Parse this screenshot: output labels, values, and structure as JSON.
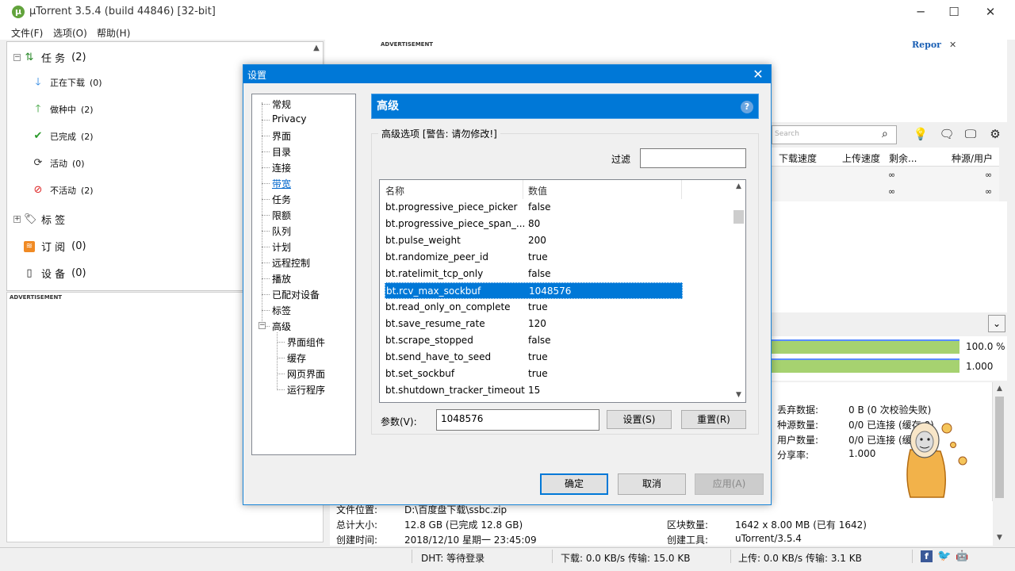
{
  "window": {
    "title": "µTorrent 3.5.4  (build 44846) [32-bit]",
    "app_icon_glyph": "µ",
    "minimize_glyph": "─",
    "maximize_glyph": "☐",
    "close_glyph": "✕"
  },
  "menu": {
    "file": "文件(F)",
    "options": "选项(O)",
    "help": "帮助(H)"
  },
  "sidebar": {
    "tasks_header": {
      "label": "任 务",
      "count": "(2)"
    },
    "items": [
      {
        "label": "正在下载",
        "count": "(0)",
        "icon": "arrow-down-icon"
      },
      {
        "label": "做种中",
        "count": "(2)",
        "icon": "arrow-up-icon"
      },
      {
        "label": "已完成",
        "count": "(2)",
        "icon": "check-icon"
      },
      {
        "label": "活动",
        "count": "(0)",
        "icon": "refresh-icon"
      },
      {
        "label": "不活动",
        "count": "(2)",
        "icon": "inactive-icon"
      }
    ],
    "labels": {
      "label": "标 签"
    },
    "feeds": {
      "label": "订 阅",
      "count": "(0)"
    },
    "devices": {
      "label": "设 备",
      "count": "(0)"
    },
    "expand_glyph": "+",
    "collapse_glyph": "−",
    "advertisement": "ADVERTISEMENT"
  },
  "top_ad": {
    "label": "ADVERTISEMENT",
    "report": "Repor",
    "close": "✕"
  },
  "search": {
    "placeholder": "Search"
  },
  "torrent_list": {
    "columns": [
      "下载速度",
      "上传速度",
      "剩余...",
      "种源/用户"
    ],
    "rows": [
      {
        "remaining": "∞",
        "ratio": "∞"
      },
      {
        "remaining": "∞",
        "ratio": "∞"
      }
    ]
  },
  "detail_toggle": "⌄",
  "progress_bars": [
    {
      "value": "100.0 %",
      "fill": 1.0
    },
    {
      "value": "1.000",
      "fill": 1.0
    }
  ],
  "info": {
    "wasted_label": "丢弃数据:",
    "wasted_value": "0 B (0 次校验失败)",
    "seeds_label": "种源数量:",
    "seeds_value": "0/0 已连接 (缓存 0)",
    "peers_label": "用户数量:",
    "peers_value": "0/0 已连接 (缓",
    "ratio_label": "分享率:",
    "ratio_value": "1.000"
  },
  "files": {
    "location_label": "文件位置:",
    "location_value": "D:\\百度盘下载\\ssbc.zip",
    "size_label": "总计大小:",
    "size_value": "12.8 GB (已完成 12.8 GB)",
    "created_label": "创建时间:",
    "created_value": "2018/12/10 星期一 23:45:09",
    "pieces_label": "区块数量:",
    "pieces_value": "1642 x 8.00 MB (已有 1642)",
    "creator_label": "创建工具:",
    "creator_value": "uTorrent/3.5.4"
  },
  "statusbar": {
    "dht": "DHT: 等待登录",
    "download": "下载: 0.0 KB/s 传输: 15.0 KB",
    "upload": "上传: 0.0 KB/s 传输: 3.1 KB"
  },
  "dialog": {
    "title": "设置",
    "close": "✕",
    "tree": [
      "常规",
      "Privacy",
      "界面",
      "目录",
      "连接",
      "带宽",
      "任务",
      "限额",
      "队列",
      "计划",
      "远程控制",
      "播放",
      "已配对设备",
      "标签",
      "高级"
    ],
    "tree_children": [
      "界面组件",
      "缓存",
      "网页界面",
      "运行程序"
    ],
    "section_title": "高级",
    "help": "?",
    "group_title": "高级选项 [警告: 请勿修改!]",
    "filter_label": "过滤",
    "filter_value": "",
    "list_header": {
      "name": "名称",
      "value": "数值"
    },
    "rows": [
      {
        "name": "bt.progressive_piece_picker",
        "value": "false"
      },
      {
        "name": "bt.progressive_piece_span_...",
        "value": "80"
      },
      {
        "name": "bt.pulse_weight",
        "value": "200"
      },
      {
        "name": "bt.randomize_peer_id",
        "value": "true"
      },
      {
        "name": "bt.ratelimit_tcp_only",
        "value": "false"
      },
      {
        "name": "bt.rcv_max_sockbuf",
        "value": "1048576",
        "selected": true
      },
      {
        "name": "bt.read_only_on_complete",
        "value": "true"
      },
      {
        "name": "bt.save_resume_rate",
        "value": "120"
      },
      {
        "name": "bt.scrape_stopped",
        "value": "false"
      },
      {
        "name": "bt.send_have_to_seed",
        "value": "true"
      },
      {
        "name": "bt.set_sockbuf",
        "value": "true"
      },
      {
        "name": "bt.shutdown_tracker_timeout",
        "value": "15"
      }
    ],
    "scroll_up": "▲",
    "scroll_down": "▼",
    "param_label": "参数(V):",
    "param_value": "1048576",
    "set_button": "设置(S)",
    "reset_button": "重置(R)",
    "ok_button": "确定",
    "cancel_button": "取消",
    "apply_button": "应用(A)"
  },
  "colors": {
    "accent": "#0078d7",
    "progress": "#a6d270",
    "link": "#0066cc"
  }
}
